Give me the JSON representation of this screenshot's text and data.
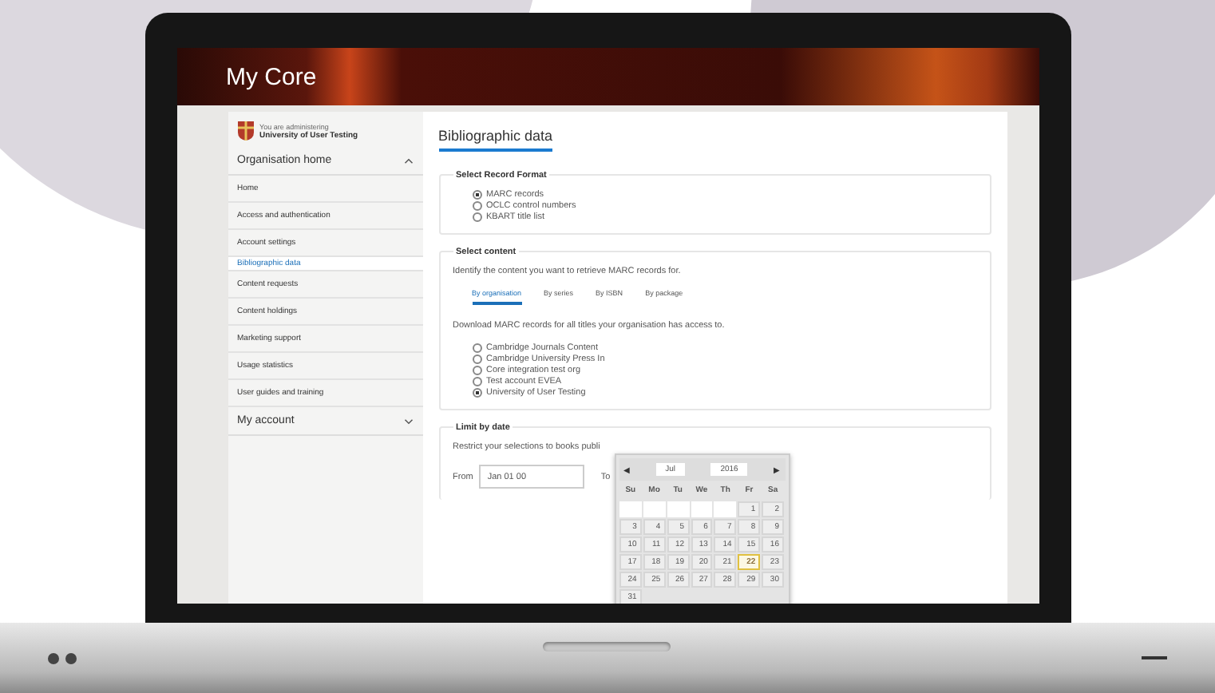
{
  "header": {
    "title": "My Core"
  },
  "sidebar": {
    "admin_label": "You are administering",
    "organisation": "University of User Testing",
    "sections": [
      {
        "label": "Organisation home",
        "expanded": true,
        "items": [
          {
            "label": "Home",
            "selected": false
          },
          {
            "label": "Access and authentication",
            "selected": false
          },
          {
            "label": "Account settings",
            "selected": false
          },
          {
            "label": "Bibliographic data",
            "selected": true
          },
          {
            "label": "Content requests",
            "selected": false
          },
          {
            "label": "Content holdings",
            "selected": false
          },
          {
            "label": "Marketing support",
            "selected": false
          },
          {
            "label": "Usage statistics",
            "selected": false
          },
          {
            "label": "User guides and training",
            "selected": false
          }
        ]
      },
      {
        "label": "My account",
        "expanded": false
      }
    ]
  },
  "main": {
    "title": "Bibliographic data",
    "record_format": {
      "legend": "Select Record Format",
      "options": [
        {
          "label": "MARC records",
          "selected": true
        },
        {
          "label": "OCLC control numbers",
          "selected": false
        },
        {
          "label": "KBART title list",
          "selected": false
        }
      ]
    },
    "content": {
      "legend": "Select content",
      "description": "Identify the content you want to retrieve MARC records for.",
      "tabs": [
        {
          "label": "By organisation",
          "selected": true
        },
        {
          "label": "By series",
          "selected": false
        },
        {
          "label": "By ISBN",
          "selected": false
        },
        {
          "label": "By package",
          "selected": false
        }
      ],
      "instruction": "Download MARC records for all titles your organisation has access to.",
      "organisations": [
        {
          "label": "Cambridge Journals Content",
          "selected": false
        },
        {
          "label": "Cambridge University Press In",
          "selected": false
        },
        {
          "label": "Core integration test org",
          "selected": false
        },
        {
          "label": "Test account EVEA",
          "selected": false
        },
        {
          "label": "University of User Testing",
          "selected": true
        }
      ]
    },
    "date": {
      "legend": "Limit by date",
      "description": "Restrict your selections to books publi",
      "from_label": "From",
      "from_value": "Jan 01 00",
      "to_label": "To"
    }
  },
  "calendar": {
    "prev": "◀",
    "next": "▶",
    "month": "Jul",
    "year": "2016",
    "weekdays": [
      "Su",
      "Mo",
      "Tu",
      "We",
      "Th",
      "Fr",
      "Sa"
    ],
    "days": [
      {
        "kind": "blank"
      },
      {
        "kind": "blank"
      },
      {
        "kind": "blank"
      },
      {
        "kind": "blank"
      },
      {
        "kind": "blank"
      },
      {
        "day": "1",
        "today": false
      },
      {
        "day": "2",
        "today": false
      },
      {
        "day": "3",
        "today": false
      },
      {
        "day": "4",
        "today": false
      },
      {
        "day": "5",
        "today": false
      },
      {
        "day": "6",
        "today": false
      },
      {
        "day": "7",
        "today": false
      },
      {
        "day": "8",
        "today": false
      },
      {
        "day": "9",
        "today": false
      },
      {
        "day": "10",
        "today": false
      },
      {
        "day": "11",
        "today": false
      },
      {
        "day": "12",
        "today": false
      },
      {
        "day": "13",
        "today": false
      },
      {
        "day": "14",
        "today": false
      },
      {
        "day": "15",
        "today": false
      },
      {
        "day": "16",
        "today": false
      },
      {
        "day": "17",
        "today": false
      },
      {
        "day": "18",
        "today": false
      },
      {
        "day": "19",
        "today": false
      },
      {
        "day": "20",
        "today": false
      },
      {
        "day": "21",
        "today": false
      },
      {
        "day": "22",
        "today": true
      },
      {
        "day": "23",
        "today": false
      },
      {
        "day": "24",
        "today": false
      },
      {
        "day": "25",
        "today": false
      },
      {
        "day": "26",
        "today": false
      },
      {
        "day": "27",
        "today": false
      },
      {
        "day": "28",
        "today": false
      },
      {
        "day": "29",
        "today": false
      },
      {
        "day": "30",
        "today": false
      },
      {
        "day": "31",
        "today": false
      }
    ]
  }
}
